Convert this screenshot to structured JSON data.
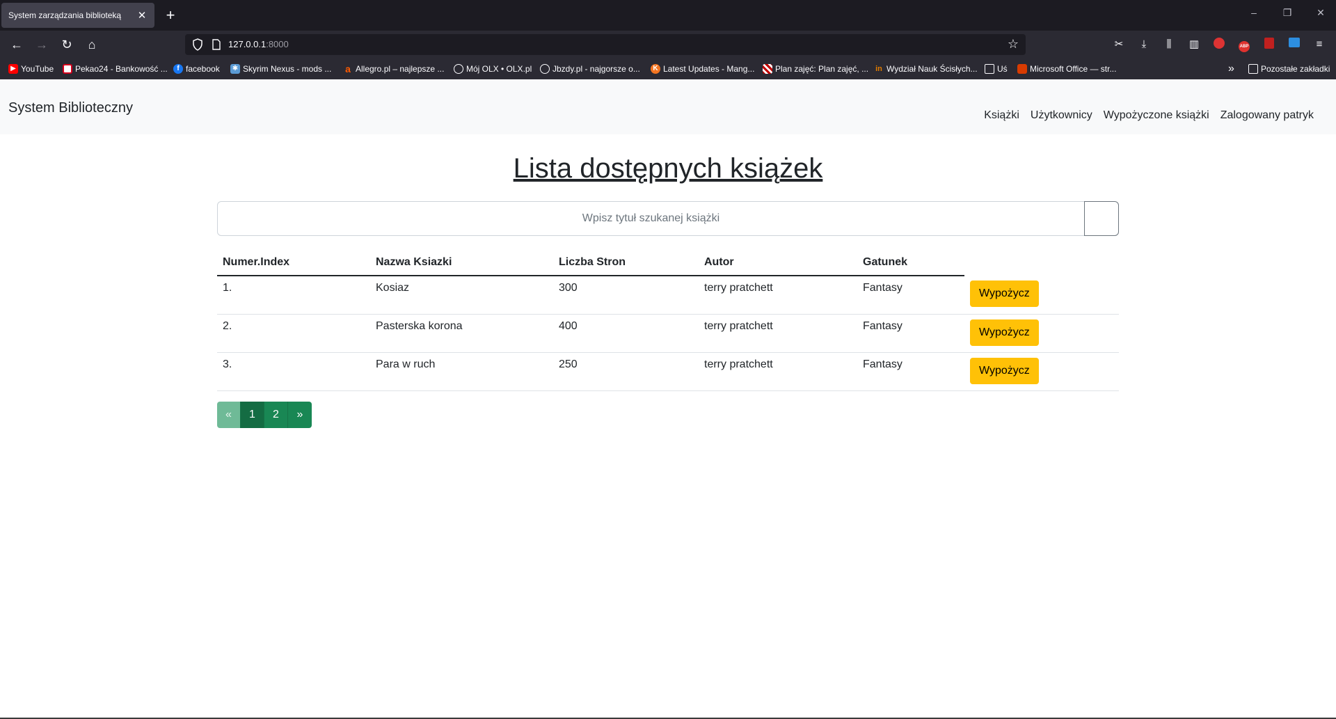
{
  "browser": {
    "tab_title": "System zarządzania biblioteką",
    "tab_close": "✕",
    "new_tab": "+",
    "url_host": "127.0.0.1",
    "url_port": ":8000",
    "window_controls": {
      "minimize": "–",
      "restore": "❐",
      "close": "✕"
    },
    "bookmarks": [
      {
        "label": "YouTube",
        "icon": "youtube-icon",
        "color": "#ff0000"
      },
      {
        "label": "Pekao24 - Bankowość ...",
        "icon": "pekao-icon",
        "color": "#d6001c"
      },
      {
        "label": "facebook",
        "icon": "facebook-icon",
        "color": "#1877f2"
      },
      {
        "label": "Skyrim Nexus - mods ...",
        "icon": "nexus-icon",
        "color": "#5b9bd5"
      },
      {
        "label": "Allegro.pl – najlepsze ...",
        "icon": "allegro-icon",
        "color": "#ff5a00"
      },
      {
        "label": "Mój OLX • OLX.pl",
        "icon": "globe-icon",
        "color": "#2b2a33"
      },
      {
        "label": "Jbzdy.pl - najgorsze o...",
        "icon": "globe-icon",
        "color": "#2b2a33"
      },
      {
        "label": "Latest Updates - Mang...",
        "icon": "manga-icon",
        "color": "#f47521"
      },
      {
        "label": "Plan zajęć: Plan zajęć, ...",
        "icon": "plan-icon",
        "color": "#c00000"
      },
      {
        "label": "Wydział Nauk Ścisłych...",
        "icon": "university-icon",
        "color": "#e07b00"
      },
      {
        "label": "Uś",
        "icon": "folder-icon",
        "color": "#2b2a33"
      },
      {
        "label": "Microsoft Office — str...",
        "icon": "office-icon",
        "color": "#d83b01"
      }
    ],
    "overflow_label": "»",
    "other_bookmarks": "Pozostałe zakładki"
  },
  "site": {
    "brand": "System Biblioteczny",
    "nav": [
      "Książki",
      "Użytkownicy",
      "Wypożyczone książki",
      "Zalogowany patryk"
    ]
  },
  "main": {
    "title": "Lista dostępnych książek",
    "search_placeholder": "Wpisz tytuł szukanej książki",
    "columns": [
      "Numer.Index",
      "Nazwa Ksiazki",
      "Liczba Stron",
      "Autor",
      "Gatunek"
    ],
    "rows": [
      {
        "index": "1.",
        "name": "Kosiaz",
        "pages": "300",
        "author": "terry pratchett",
        "genre": "Fantasy",
        "action": "Wypożycz"
      },
      {
        "index": "2.",
        "name": "Pasterska korona",
        "pages": "400",
        "author": "terry pratchett",
        "genre": "Fantasy",
        "action": "Wypożycz"
      },
      {
        "index": "3.",
        "name": "Para w ruch",
        "pages": "250",
        "author": "terry pratchett",
        "genre": "Fantasy",
        "action": "Wypożycz"
      }
    ],
    "pagination": {
      "prev": "«",
      "pages": [
        "1",
        "2"
      ],
      "next": "»",
      "active": "1"
    }
  },
  "colors": {
    "accent_warning": "#ffc107",
    "success": "#198754",
    "navbar_bg": "#f8f9fa"
  }
}
